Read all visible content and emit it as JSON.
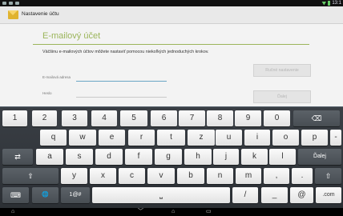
{
  "status_bar": {
    "time": "13:1"
  },
  "action_bar": {
    "title": "Nastavenie účtu",
    "icon": "envelope-icon"
  },
  "form": {
    "heading": "E-mailový účet",
    "description": "Väčšinu e-mailových účtov môžete nastaviť pomocou niekoľkých jednoduchých krokov.",
    "email_label": "E-mailová adresa",
    "email_value": "",
    "password_label": "Heslo",
    "password_value": "",
    "manual_button": "Ručné nastavenie",
    "next_button": "Ďalej"
  },
  "keyboard": {
    "row1": [
      "1",
      "2",
      "3",
      "4",
      "5",
      "6",
      "7",
      "8",
      "9",
      "0"
    ],
    "backspace_icon": "⌫",
    "row2": [
      "q",
      "w",
      "e",
      "r",
      "t",
      "z",
      "u",
      "i",
      "o",
      "p",
      "-"
    ],
    "tab_icon": "⇄",
    "row3": [
      "a",
      "s",
      "d",
      "f",
      "g",
      "h",
      "j",
      "k",
      "l"
    ],
    "enter_label": "Ďalej",
    "shift_icon": "⇧",
    "row4": [
      "y",
      "x",
      "c",
      "v",
      "b",
      "n",
      "m",
      ",",
      "."
    ],
    "settings_icon": "⌨",
    "globe_icon": "🌐",
    "symbols_label": "1@#",
    "space_icon": "⎵",
    "slash": "/",
    "underscore": "_",
    "at": "@",
    "dotcom": ".com"
  },
  "nav_bar": {
    "back_icon": "⌂",
    "down_icon": "﹀",
    "home_icon": "⌂",
    "recent_icon": "▭"
  }
}
